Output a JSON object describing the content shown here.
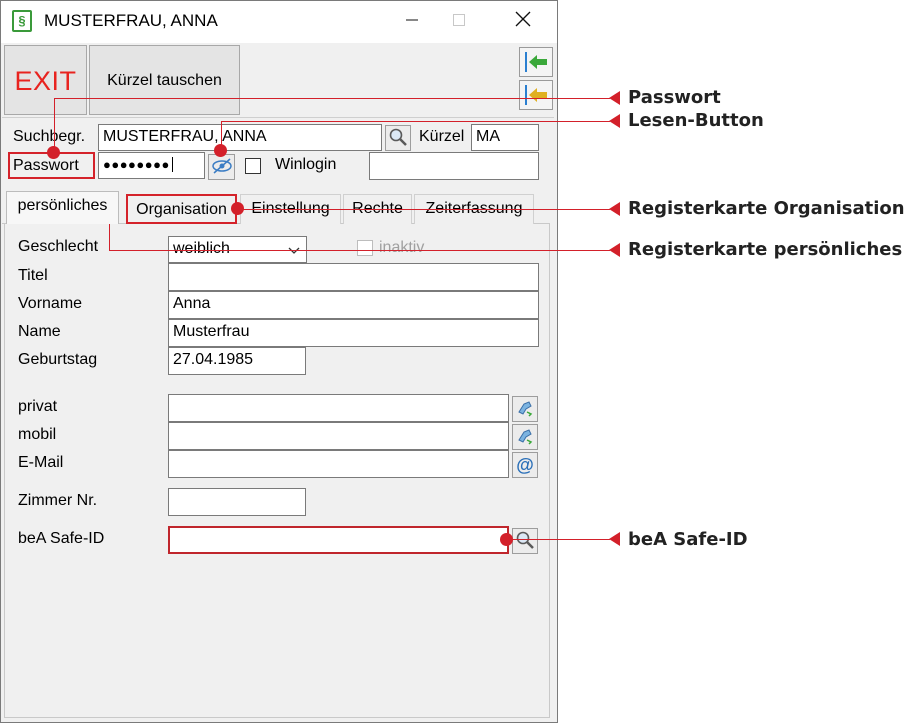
{
  "window": {
    "title": "MUSTERFRAU, ANNA",
    "icon_symbol": "§"
  },
  "toolbar": {
    "exit_label": "EXIT",
    "kurzel_label": "Kürzel tauschen"
  },
  "header_fields": {
    "suchbegr_label": "Suchbegr.",
    "suchbegr_value": "MUSTERFRAU, ANNA",
    "kurzel_label": "Kürzel",
    "kurzel_value": "MA",
    "passwort_label": "Passwort",
    "passwort_value": "●●●●●●●●",
    "winlogin_label": "Winlogin",
    "winlogin_checked": false,
    "winlogin_value": ""
  },
  "tabs": [
    {
      "label": "persönliches",
      "active": true
    },
    {
      "label": "Organisation"
    },
    {
      "label": "Einstellung"
    },
    {
      "label": "Rechte"
    },
    {
      "label": "Zeiterfassung"
    }
  ],
  "form": {
    "geschlecht_label": "Geschlecht",
    "geschlecht_value": "weiblich",
    "inaktiv_label": "inaktiv",
    "titel_label": "Titel",
    "titel_value": "",
    "vorname_label": "Vorname",
    "vorname_value": "Anna",
    "name_label": "Name",
    "name_value": "Musterfrau",
    "geburtstag_label": "Geburtstag",
    "geburtstag_value": "27.04.1985",
    "privat_label": "privat",
    "privat_value": "",
    "mobil_label": "mobil",
    "mobil_value": "",
    "email_label": "E-Mail",
    "email_value": "",
    "email_button_symbol": "@",
    "zimmer_label": "Zimmer Nr.",
    "zimmer_value": "",
    "bea_label": "beA Safe-ID",
    "bea_value": ""
  },
  "callouts": {
    "passwort": "Passwort",
    "lesen_button": "Lesen-Button",
    "registerkarte_organisation": "Registerkarte Organisation",
    "registerkarte_persoenliches": "Registerkarte persönliches",
    "bea_safe_id": "beA Safe-ID"
  },
  "colors": {
    "exit_text": "#e8231f",
    "annotation": "#d3202a",
    "arrow_green": "#3aa83a",
    "arrow_yellow": "#e0b020"
  }
}
